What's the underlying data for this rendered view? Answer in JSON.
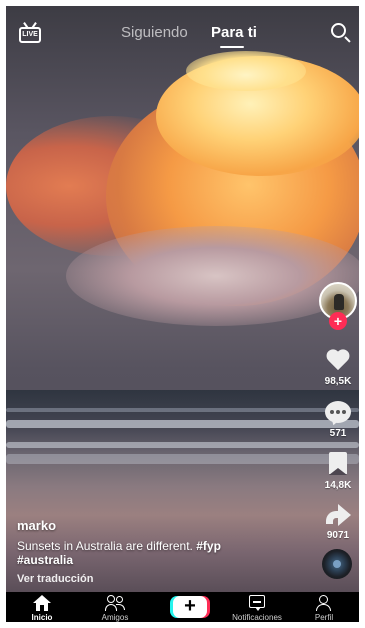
{
  "app": {
    "accent_color": "#fe2c55",
    "accent_secondary": "#25f4ee"
  },
  "topbar": {
    "live_label": "LIVE",
    "tabs": [
      {
        "label": "Siguiendo",
        "active": false
      },
      {
        "label": "Para ti",
        "active": true
      }
    ],
    "search_icon": "search-icon"
  },
  "video": {
    "username": "marko",
    "description": "Sunsets in Australia are different.",
    "hashtags": [
      "#fyp",
      "#australia"
    ],
    "translate_label": "Ver traducción"
  },
  "rail": {
    "follow_symbol": "+",
    "likes": "98,5K",
    "comments": "571",
    "saves": "14,8K",
    "shares": "9071"
  },
  "nav": {
    "items": [
      {
        "label": "Inicio",
        "icon": "home-icon",
        "active": true
      },
      {
        "label": "Amigos",
        "icon": "friends-icon",
        "active": false
      },
      {
        "label": "+",
        "icon": "create-icon",
        "active": false
      },
      {
        "label": "Notificaciones",
        "icon": "inbox-icon",
        "active": false
      },
      {
        "label": "Perfil",
        "icon": "profile-icon",
        "active": false
      }
    ]
  }
}
